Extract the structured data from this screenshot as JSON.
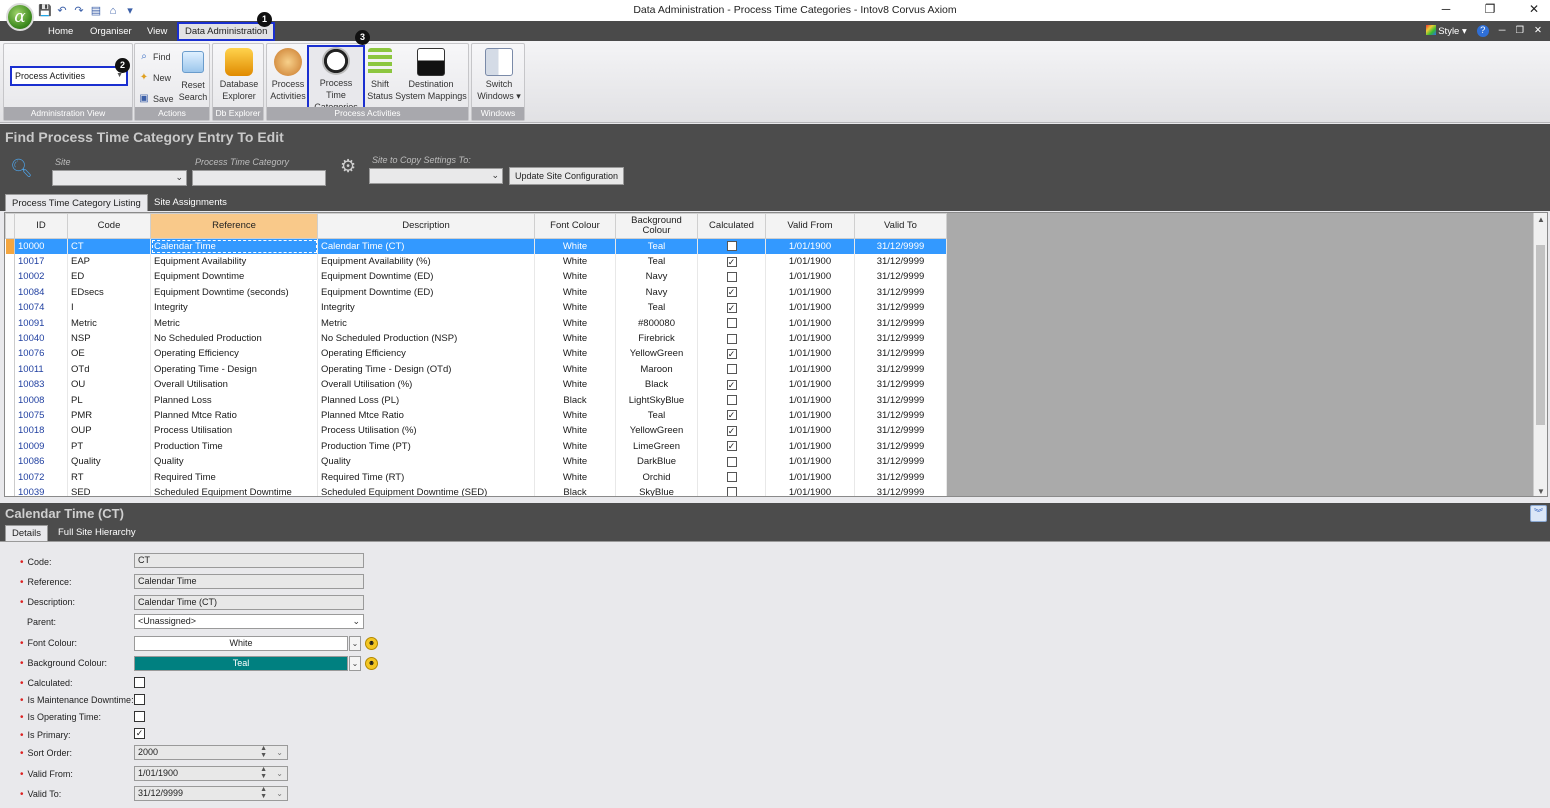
{
  "window": {
    "title": "Data Administration - Process Time Categories - Intov8 Corvus Axiom"
  },
  "app": {
    "orb_glyph": "α"
  },
  "ribbon_tabs": [
    {
      "label": "Home"
    },
    {
      "label": "Organiser"
    },
    {
      "label": "View"
    },
    {
      "label": "Data Administration",
      "active": true
    }
  ],
  "ribbon_right": {
    "style_label": "Style",
    "help": "?"
  },
  "badges": [
    "1",
    "2",
    "3"
  ],
  "ribbon": {
    "admin_view": {
      "value": "Process Activities",
      "group_label": "Administration View"
    },
    "actions": {
      "find": "Find",
      "new": "New",
      "save": "Save",
      "reset_line1": "Reset",
      "reset_line2": "Search",
      "group_label": "Actions"
    },
    "db_explorer": {
      "line1": "Database",
      "line2": "Explorer",
      "group_label": "Db Explorer"
    },
    "process": {
      "activities_line1": "Process",
      "activities_line2": "Activities",
      "time_cat_line1": "Process Time",
      "time_cat_line2": "Categories",
      "shift_line1": "Shift",
      "shift_line2": "Status",
      "dest_line1": "Destination",
      "dest_line2": "System Mappings",
      "group_label": "Process Activities"
    },
    "windows": {
      "line1": "Switch",
      "line2": "Windows",
      "group_label": "Windows"
    }
  },
  "find": {
    "title": "Find Process Time Category Entry To Edit",
    "site_label": "Site",
    "ptc_label": "Process Time Category",
    "copy_label": "Site to Copy Settings To:",
    "update_button": "Update Site Configuration"
  },
  "list_tabs": [
    "Process Time Category Listing",
    "Site Assignments"
  ],
  "grid": {
    "columns": [
      "ID",
      "Code",
      "Reference",
      "Description",
      "Font Colour",
      "Background Colour",
      "Calculated",
      "Valid From",
      "Valid To"
    ],
    "rows": [
      {
        "id": "10000",
        "code": "CT",
        "ref": "Calendar Time",
        "desc": "Calendar Time (CT)",
        "font": "White",
        "bg": "Teal",
        "calc": false,
        "from": "1/01/1900",
        "to": "31/12/9999",
        "selected": true
      },
      {
        "id": "10017",
        "code": "EAP",
        "ref": "Equipment Availability",
        "desc": "Equipment Availability (%)",
        "font": "White",
        "bg": "Teal",
        "calc": true,
        "from": "1/01/1900",
        "to": "31/12/9999"
      },
      {
        "id": "10002",
        "code": "ED",
        "ref": "Equipment Downtime",
        "desc": "Equipment Downtime (ED)",
        "font": "White",
        "bg": "Navy",
        "calc": false,
        "from": "1/01/1900",
        "to": "31/12/9999"
      },
      {
        "id": "10084",
        "code": "EDsecs",
        "ref": "Equipment Downtime (seconds)",
        "desc": "Equipment Downtime (ED)",
        "font": "White",
        "bg": "Navy",
        "calc": true,
        "from": "1/01/1900",
        "to": "31/12/9999"
      },
      {
        "id": "10074",
        "code": "I",
        "ref": "Integrity",
        "desc": "Integrity",
        "font": "White",
        "bg": "Teal",
        "calc": true,
        "from": "1/01/1900",
        "to": "31/12/9999"
      },
      {
        "id": "10091",
        "code": "Metric",
        "ref": "Metric",
        "desc": "Metric",
        "font": "White",
        "bg": "#800080",
        "calc": false,
        "from": "1/01/1900",
        "to": "31/12/9999"
      },
      {
        "id": "10040",
        "code": "NSP",
        "ref": "No Scheduled Production",
        "desc": "No Scheduled Production (NSP)",
        "font": "White",
        "bg": "Firebrick",
        "calc": false,
        "from": "1/01/1900",
        "to": "31/12/9999"
      },
      {
        "id": "10076",
        "code": "OE",
        "ref": "Operating Efficiency",
        "desc": "Operating Efficiency",
        "font": "White",
        "bg": "YellowGreen",
        "calc": true,
        "from": "1/01/1900",
        "to": "31/12/9999"
      },
      {
        "id": "10011",
        "code": "OTd",
        "ref": "Operating Time - Design",
        "desc": "Operating Time - Design (OTd)",
        "font": "White",
        "bg": "Maroon",
        "calc": false,
        "from": "1/01/1900",
        "to": "31/12/9999"
      },
      {
        "id": "10083",
        "code": "OU",
        "ref": "Overall Utilisation",
        "desc": "Overall Utilisation (%)",
        "font": "White",
        "bg": "Black",
        "calc": true,
        "from": "1/01/1900",
        "to": "31/12/9999"
      },
      {
        "id": "10008",
        "code": "PL",
        "ref": "Planned Loss",
        "desc": "Planned Loss (PL)",
        "font": "Black",
        "bg": "LightSkyBlue",
        "calc": false,
        "from": "1/01/1900",
        "to": "31/12/9999"
      },
      {
        "id": "10075",
        "code": "PMR",
        "ref": "Planned Mtce Ratio",
        "desc": "Planned Mtce Ratio",
        "font": "White",
        "bg": "Teal",
        "calc": true,
        "from": "1/01/1900",
        "to": "31/12/9999"
      },
      {
        "id": "10018",
        "code": "OUP",
        "ref": "Process Utilisation",
        "desc": "Process Utilisation (%)",
        "font": "White",
        "bg": "YellowGreen",
        "calc": true,
        "from": "1/01/1900",
        "to": "31/12/9999"
      },
      {
        "id": "10009",
        "code": "PT",
        "ref": "Production Time",
        "desc": "Production Time (PT)",
        "font": "White",
        "bg": "LimeGreen",
        "calc": true,
        "from": "1/01/1900",
        "to": "31/12/9999"
      },
      {
        "id": "10086",
        "code": "Quality",
        "ref": "Quality",
        "desc": "Quality",
        "font": "White",
        "bg": "DarkBlue",
        "calc": false,
        "from": "1/01/1900",
        "to": "31/12/9999"
      },
      {
        "id": "10072",
        "code": "RT",
        "ref": "Required Time",
        "desc": "Required Time (RT)",
        "font": "White",
        "bg": "Orchid",
        "calc": false,
        "from": "1/01/1900",
        "to": "31/12/9999"
      },
      {
        "id": "10039",
        "code": "SED",
        "ref": "Scheduled Equipment Downtime",
        "desc": "Scheduled Equipment Downtime (SED)",
        "font": "Black",
        "bg": "SkyBlue",
        "calc": false,
        "from": "1/01/1900",
        "to": "31/12/9999"
      }
    ]
  },
  "detail": {
    "title": "Calendar Time (CT)",
    "tabs": [
      "Details",
      "Full Site Hierarchy"
    ],
    "labels": {
      "code": "Code:",
      "reference": "Reference:",
      "description": "Description:",
      "parent": "Parent:",
      "font_colour": "Font Colour:",
      "bg_colour": "Background Colour:",
      "calculated": "Calculated:",
      "maint": "Is Maintenance Downtime:",
      "optime": "Is Operating Time:",
      "primary": "Is Primary:",
      "sort": "Sort Order:",
      "from": "Valid From:",
      "to": "Valid To:"
    },
    "values": {
      "code": "CT",
      "reference": "Calendar Time",
      "description": "Calendar Time (CT)",
      "parent": "<Unassigned>",
      "font_colour": "White",
      "bg_colour": "Teal",
      "sort": "2000",
      "from": "1/01/1900",
      "to": "31/12/9999"
    },
    "checks": {
      "calculated": false,
      "maint": false,
      "optime": false,
      "primary": true
    },
    "colors": {
      "font_swatch": "#ffffff",
      "bg_swatch": "#008080"
    }
  },
  "theme": {
    "accent_highlight": "#1a2fd0",
    "selection": "#3399ff",
    "sorted_header": "#f9c98a"
  }
}
